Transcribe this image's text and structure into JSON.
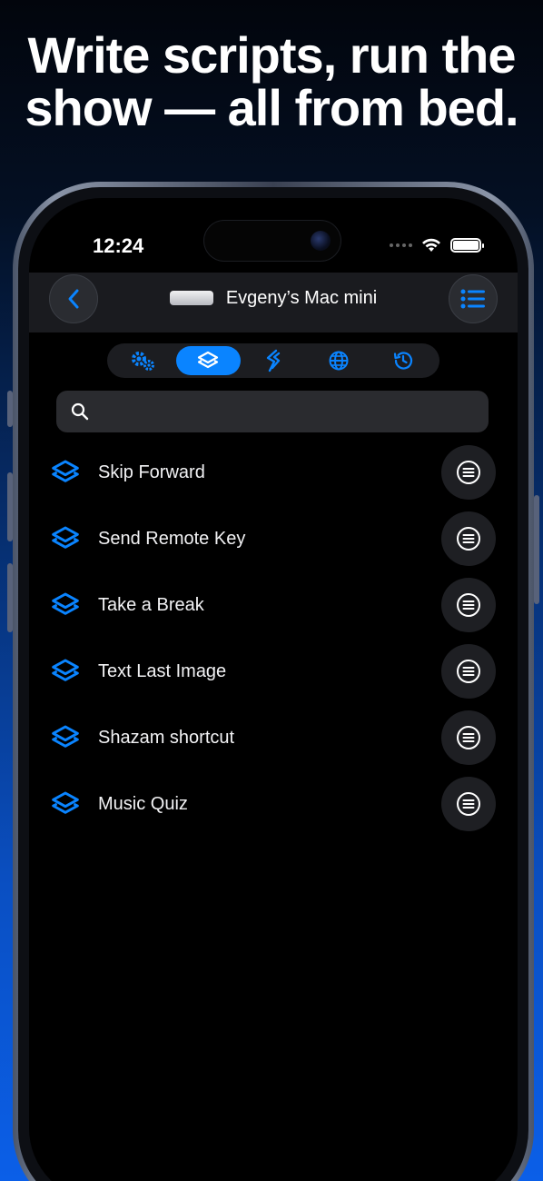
{
  "headline": {
    "line1": "Write scripts, run the",
    "line2": "show — all from bed."
  },
  "status_bar": {
    "time": "12:24"
  },
  "nav": {
    "title": "Evgeny’s Mac mini"
  },
  "tabs": [
    "gears-icon",
    "shortcuts-icon",
    "scriptable-icon",
    "globe-icon",
    "history-icon"
  ],
  "active_tab": 1,
  "search": {
    "placeholder": ""
  },
  "shortcuts": [
    {
      "label": "Skip Forward"
    },
    {
      "label": "Send Remote Key"
    },
    {
      "label": "Take a Break"
    },
    {
      "label": "Text Last Image"
    },
    {
      "label": "Shazam shortcut"
    },
    {
      "label": "Music Quiz"
    }
  ],
  "colors": {
    "accent": "#0a84ff",
    "background": "#000000"
  }
}
